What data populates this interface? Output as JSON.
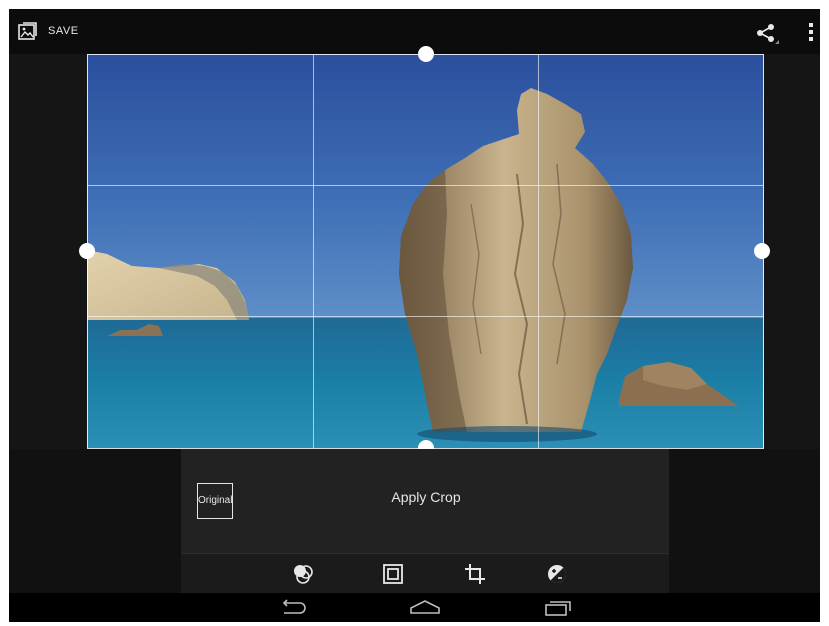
{
  "action_bar": {
    "save_label": "SAVE",
    "save_icon": "photo-save-icon",
    "share_icon": "share-icon",
    "overflow_icon": "overflow-menu-icon"
  },
  "editor": {
    "image": "coastal rock formation in blue sea",
    "crop_grid": "rule-of-thirds"
  },
  "panel": {
    "original_label": "Original",
    "apply_label": "Apply Crop"
  },
  "toolbar": {
    "tools": [
      "filters-icon",
      "frames-icon",
      "crop-icon",
      "exposure-icon"
    ]
  },
  "nav": {
    "buttons": [
      "back-icon",
      "home-icon",
      "recent-apps-icon"
    ]
  },
  "colors": {
    "background": "#111111",
    "panel": "#222222",
    "toolbar": "#1b1b1b",
    "text": "#e6e6e6"
  }
}
